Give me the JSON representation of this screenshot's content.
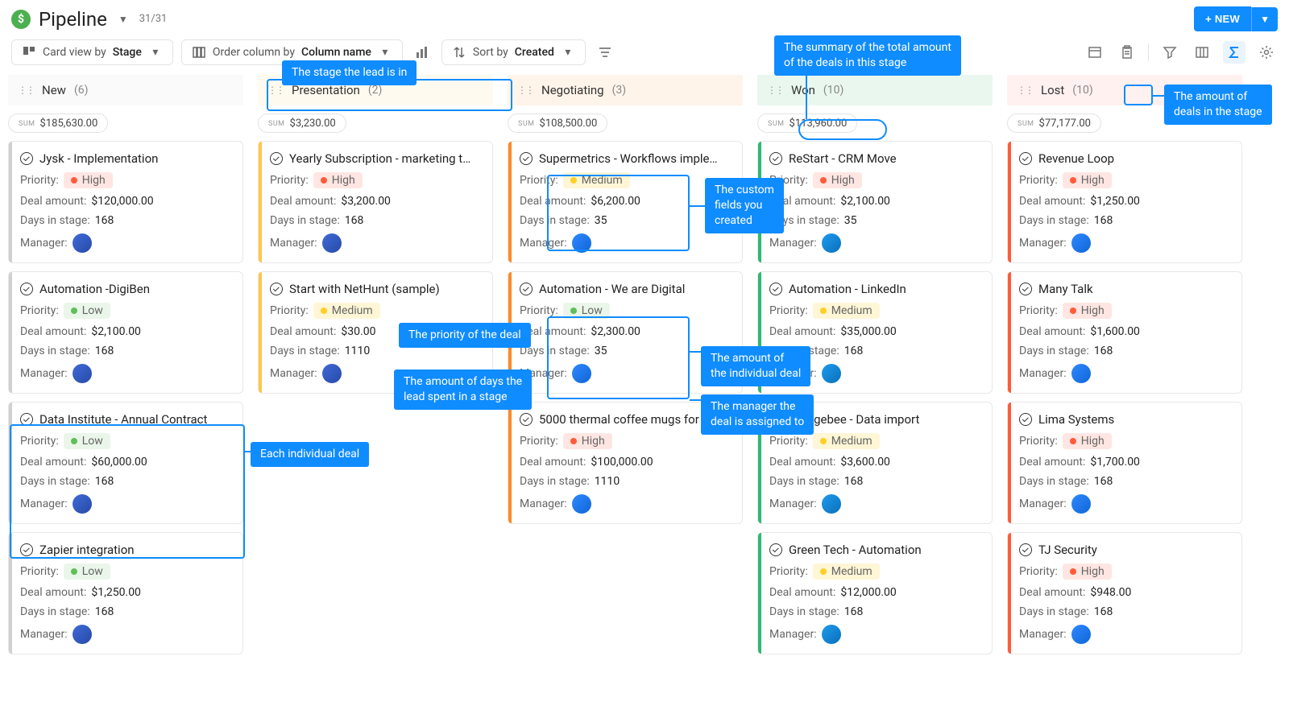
{
  "header": {
    "title": "Pipeline",
    "counter": "31/31",
    "newBtn": "+ NEW"
  },
  "toolbar": {
    "cardViewPrefix": "Card view by ",
    "cardViewStrong": "Stage",
    "orderPrefix": "Order column by ",
    "orderStrong": "Column name",
    "sortPrefix": "Sort by ",
    "sortStrong": "Created"
  },
  "priorityStyles": {
    "High": {
      "bg": "#ffe6e2",
      "dot": "#ff5b3a"
    },
    "Medium": {
      "bg": "#fff6d6",
      "dot": "#ffcf26"
    },
    "Low": {
      "bg": "#eaf6e9",
      "dot": "#5fbf58"
    }
  },
  "avatars": {
    "a": "linear-gradient(135deg,#3f6ad8,#274aa6)",
    "b": "linear-gradient(135deg,#2f88ff,#1066d6)",
    "c": "linear-gradient(135deg,#1d9bf0,#0b6fb8)"
  },
  "labels": {
    "priority": "Priority:",
    "dealAmount": "Deal amount:",
    "daysInStage": "Days in stage:",
    "manager": "Manager:",
    "sum": "sum"
  },
  "callouts": {
    "stage": "The stage the lead is in",
    "sumAmount": "The summary of the total amount\nof the deals in this stage",
    "dealCount": "The amount of\ndeals in the stage",
    "customFields": "The custom\nfields you\ncreated",
    "priority": "The priority of the deal",
    "days": "The amount of days the\nlead spent in a stage",
    "individualAmount": "The amount of\nthe individual deal",
    "managerAssigned": "The manager the\ndeal is assigned to",
    "individualDeal": "Each individual deal"
  },
  "columns": [
    {
      "name": "New",
      "count": 6,
      "headerBg": "#fafafa",
      "barColor": "#d0d0d0",
      "sum": "$185,630.00",
      "cards": [
        {
          "name": "Jysk - Implementation",
          "priority": "High",
          "amount": "$120,000.00",
          "days": "168",
          "avatar": "a"
        },
        {
          "name": "Automation -DigiBen",
          "priority": "Low",
          "amount": "$2,100.00",
          "days": "168",
          "avatar": "a"
        },
        {
          "name": "Data Institute - Annual Contract",
          "priority": "Low",
          "amount": "$60,000.00",
          "days": "168",
          "avatar": "a"
        },
        {
          "name": "Zapier integration",
          "priority": "Low",
          "amount": "$1,250.00",
          "days": "168",
          "avatar": "a"
        }
      ]
    },
    {
      "name": "Presentation",
      "count": 2,
      "headerBg": "#fffaf0",
      "barColor": "#ffc64b",
      "sum": "$3,230.00",
      "cards": [
        {
          "name": "Yearly Subscription - marketing t…",
          "priority": "High",
          "amount": "$3,200.00",
          "days": "168",
          "avatar": "a"
        },
        {
          "name": "Start with NetHunt (sample)",
          "priority": "Medium",
          "amount": "$30.00",
          "days": "1110",
          "avatar": "a"
        }
      ]
    },
    {
      "name": "Negotiating",
      "count": 3,
      "headerBg": "#fff4ea",
      "barColor": "#ff8a2a",
      "sum": "$108,500.00",
      "cards": [
        {
          "name": "Supermetrics - Workflows imple…",
          "priority": "Medium",
          "amount": "$6,200.00",
          "days": "35",
          "avatar": "b"
        },
        {
          "name": "Automation - We are Digital",
          "priority": "Low",
          "amount": "$2,300.00",
          "days": "35",
          "avatar": "b"
        },
        {
          "name": "5000 thermal coffee mugs for …",
          "priority": "High",
          "amount": "$100,000.00",
          "days": "1110",
          "avatar": "b"
        }
      ]
    },
    {
      "name": "Won",
      "count": 10,
      "headerBg": "#e9f7ee",
      "barColor": "#2fb972",
      "sum": "$113,960.00",
      "cards": [
        {
          "name": "ReStart - CRM Move",
          "priority": "High",
          "amount": "$2,100.00",
          "days": "35",
          "avatar": "c"
        },
        {
          "name": "Automation - LinkedIn",
          "priority": "Medium",
          "amount": "$35,000.00",
          "days": "168",
          "avatar": "c"
        },
        {
          "name": "Chargebee - Data import",
          "priority": "Medium",
          "amount": "$3,600.00",
          "days": "168",
          "avatar": "c"
        },
        {
          "name": "Green Tech - Automation",
          "priority": "Medium",
          "amount": "$12,000.00",
          "days": "168",
          "avatar": "c"
        }
      ]
    },
    {
      "name": "Lost",
      "count": 10,
      "headerBg": "#fff1ef",
      "barColor": "#ff5b3a",
      "sum": "$77,177.00",
      "cards": [
        {
          "name": "Revenue Loop",
          "priority": "High",
          "amount": "$1,250.00",
          "days": "168",
          "avatar": "b"
        },
        {
          "name": "Many Talk",
          "priority": "High",
          "amount": "$1,600.00",
          "days": "168",
          "avatar": "b"
        },
        {
          "name": "Lima Systems",
          "priority": "High",
          "amount": "$1,700.00",
          "days": "168",
          "avatar": "b"
        },
        {
          "name": "TJ Security",
          "priority": "High",
          "amount": "$948.00",
          "days": "168",
          "avatar": "b"
        }
      ]
    }
  ]
}
